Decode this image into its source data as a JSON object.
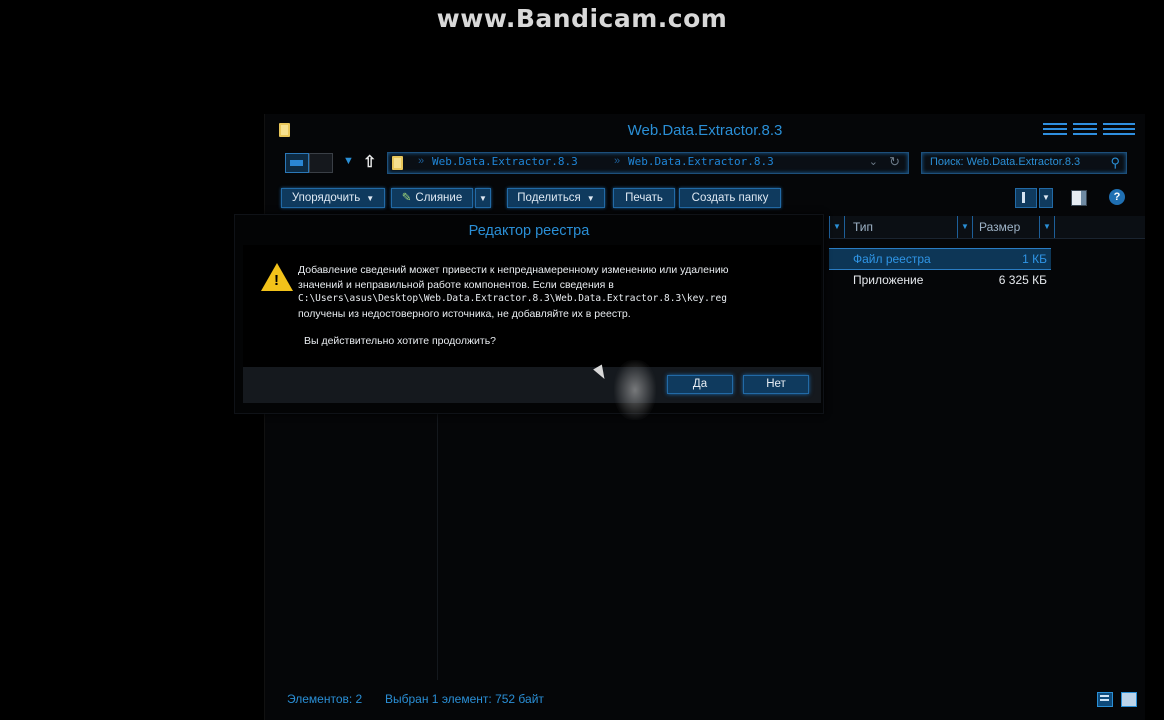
{
  "watermark": "www.Bandicam.com",
  "explorer": {
    "title": "Web.Data.Extractor.8.3",
    "address": [
      "Web.Data.Extractor.8.3",
      "Web.Data.Extractor.8.3"
    ],
    "search_placeholder": "Поиск: Web.Data.Extractor.8.3",
    "toolbar": {
      "organize": "Упорядочить",
      "merge": "Слияние",
      "share": "Поделиться",
      "print": "Печать",
      "new_folder": "Создать папку",
      "help": "?"
    },
    "columns": {
      "type": "Тип",
      "size": "Размер"
    },
    "files": [
      {
        "type": "Файл реестра",
        "size": "1 КБ",
        "selected": true
      },
      {
        "type": "Приложение",
        "size": "6 325 КБ",
        "selected": false
      }
    ],
    "status": {
      "count": "Элементов: 2",
      "selection": "Выбран 1 элемент: 752 байт"
    }
  },
  "dialog": {
    "title": "Редактор реестра",
    "message_line1": "Добавление сведений может привести к непреднамеренному изменению или удалению",
    "message_line2": "значений и неправильной работе компонентов. Если сведения в",
    "message_path": "C:\\Users\\asus\\Desktop\\Web.Data.Extractor.8.3\\Web.Data.Extractor.8.3\\key.reg",
    "message_line4": "получены из недостоверного источника, не добавляйте их в реестр.",
    "question": "Вы действительно хотите продолжить?",
    "yes": "Да",
    "no": "Нет"
  },
  "colors": {
    "accent": "#2a8fd6",
    "button": "#0f3a5e",
    "warning": "#f2c21a"
  }
}
